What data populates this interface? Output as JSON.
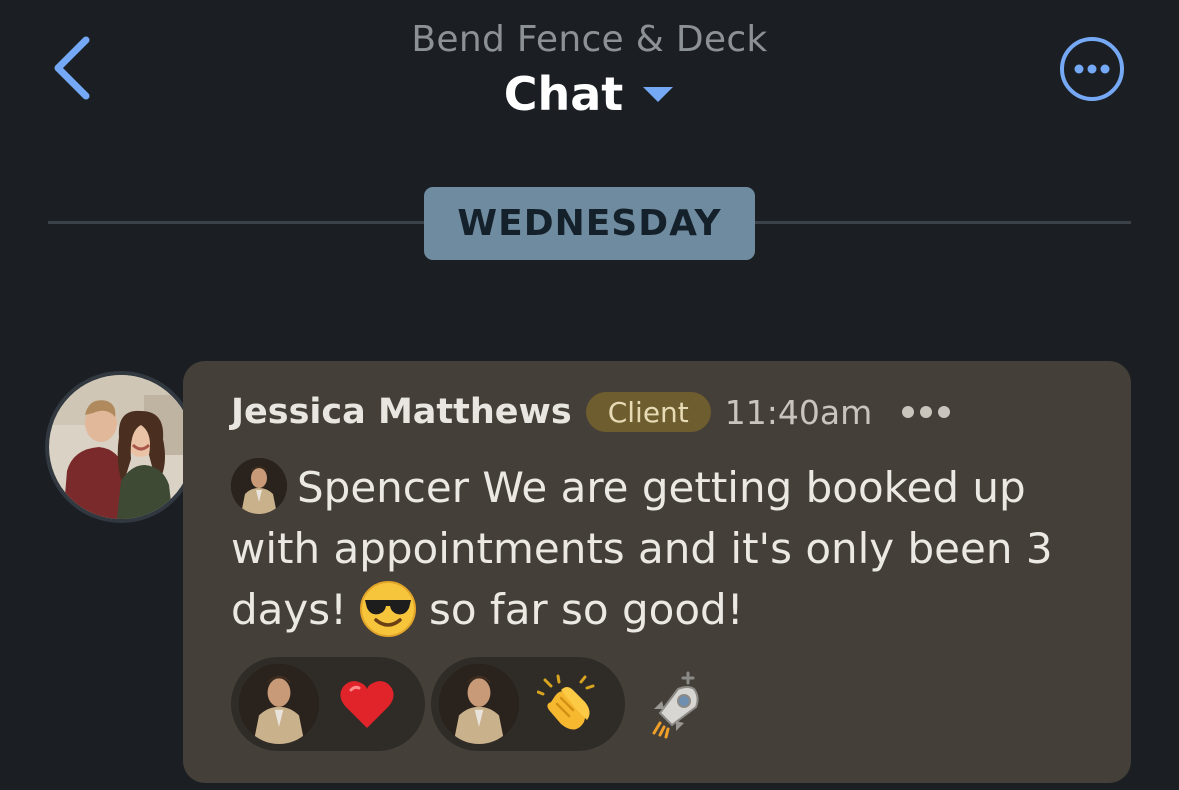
{
  "header": {
    "subtitle": "Bend Fence & Deck",
    "title": "Chat"
  },
  "divider": {
    "label": "WEDNESDAY"
  },
  "message": {
    "sender": "Jessica Matthews",
    "role": "Client",
    "time": "11:40am",
    "mention": "Spencer",
    "text_before_emoji": " We are getting booked up with appointments and it's only been 3 days!",
    "inline_emoji": "smiling-face-with-sunglasses",
    "text_after_emoji": "so far so good!",
    "reactions": [
      {
        "emoji": "red-heart"
      },
      {
        "emoji": "clapping-hands"
      }
    ]
  },
  "colors": {
    "background": "#1b1f24",
    "accent": "#76a9f5",
    "card": "#443f38",
    "badge": "#6e5d2e",
    "divider_pill": "#6f8ba0"
  }
}
